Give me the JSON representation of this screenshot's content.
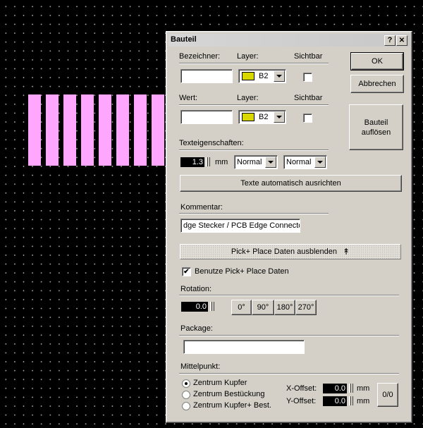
{
  "window": {
    "title": "Bauteil",
    "help_btn": "?",
    "close_btn": "✕"
  },
  "bezeichner": {
    "label": "Bezeichner:",
    "layer_label": "Layer:",
    "sichtbar_label": "Sichtbar",
    "value": "",
    "layer": "B2",
    "layer_color": "#d8d800"
  },
  "wert": {
    "label": "Wert:",
    "layer_label": "Layer:",
    "sichtbar_label": "Sichtbar",
    "value": "",
    "layer": "B2",
    "layer_color": "#d8d800"
  },
  "text_props": {
    "label": "Texteigenschaften:",
    "size": "1.3",
    "unit": "mm",
    "style1": "Normal",
    "style2": "Normal",
    "auto_align": "Texte automatisch ausrichten"
  },
  "kommentar": {
    "label": "Kommentar:",
    "value": "dge Stecker / PCB Edge Connector"
  },
  "pickplace": {
    "hide_btn": "Pick+ Place Daten ausblenden",
    "arrow": "↟",
    "use_label": "Benutze Pick+ Place Daten",
    "use_checked": "✔"
  },
  "rotation": {
    "label": "Rotation:",
    "value": "0.0",
    "buttons": [
      "0°",
      "90°",
      "180°",
      "270°"
    ]
  },
  "package": {
    "label": "Package:",
    "value": ""
  },
  "mittelpunkt": {
    "label": "Mittelpunkt:",
    "options": [
      "Zentrum Kupfer",
      "Zentrum Bestückung",
      "Zentrum Kupfer+ Best."
    ],
    "selected": 0,
    "x_label": "X-Offset:",
    "x_value": "0.0",
    "y_label": "Y-Offset:",
    "y_value": "0.0",
    "unit": "mm",
    "reset_btn": "0/0"
  },
  "buttons": {
    "ok": "OK",
    "cancel": "Abbrechen",
    "dissolve_line1": "Bauteil",
    "dissolve_line2": "auflösen"
  },
  "canvas": {
    "pad_color": "#ffa6ff",
    "pad_count": 8
  }
}
